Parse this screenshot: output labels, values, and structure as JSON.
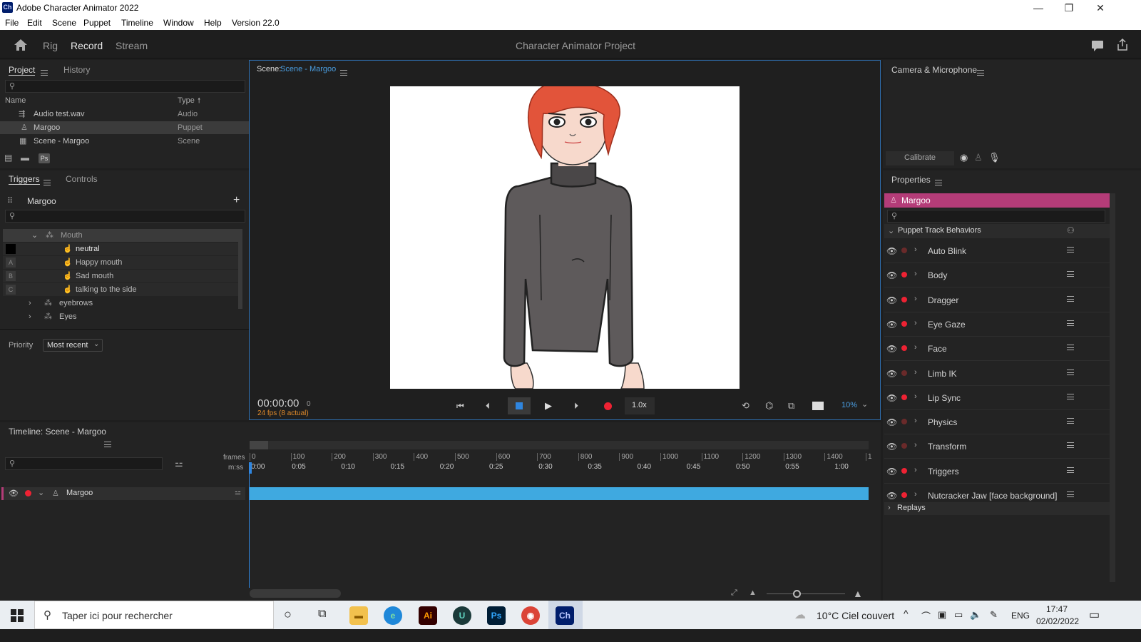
{
  "window": {
    "title": "Adobe Character Animator 2022",
    "logo_text": "Ch",
    "minimize": "—",
    "restore": "❐",
    "close": "✕"
  },
  "menu": [
    "File",
    "Edit",
    "Scene",
    "Puppet",
    "Timeline",
    "Window",
    "Help",
    "Version 22.0"
  ],
  "appbar": {
    "tabs": [
      "Rig",
      "Record",
      "Stream"
    ],
    "active": "Record",
    "project_title": "Character Animator Project"
  },
  "project_panel": {
    "tabs": [
      "Project",
      "History"
    ],
    "columns": [
      "Name",
      "Type"
    ],
    "items": [
      {
        "name": "Audio test.wav",
        "type": "Audio",
        "icon": "audio-icon"
      },
      {
        "name": "Margoo",
        "type": "Puppet",
        "icon": "puppet-icon"
      },
      {
        "name": "Scene - Margoo",
        "type": "Scene",
        "icon": "scene-icon"
      }
    ],
    "ps_label": "Ps"
  },
  "triggers_panel": {
    "tabs": [
      "Triggers",
      "Controls"
    ],
    "puppet_name": "Margoo",
    "items": [
      {
        "label": "Mouth",
        "key": ""
      },
      {
        "label": "neutral",
        "key": ""
      },
      {
        "label": "Happy mouth",
        "key": "A"
      },
      {
        "label": "Sad mouth",
        "key": "B"
      },
      {
        "label": "talking to the side",
        "key": "C"
      },
      {
        "label": "eyebrows",
        "key": ""
      },
      {
        "label": "Eyes",
        "key": ""
      }
    ],
    "priority_label": "Priority",
    "priority_value": "Most recent"
  },
  "scene_panel": {
    "label": "Scene:",
    "name": "Scene - Margoo",
    "timecode": "00:00:00",
    "frame": "0",
    "fps": "24 fps (8 actual)",
    "speed": "1.0x",
    "zoom": "10%"
  },
  "camera_panel": {
    "title": "Camera & Microphone",
    "calibrate": "Calibrate"
  },
  "properties_panel": {
    "title": "Properties",
    "puppet": "Margoo",
    "section": "Puppet Track Behaviors",
    "behaviors": [
      {
        "label": "Auto Blink",
        "armed": false
      },
      {
        "label": "Body",
        "armed": true
      },
      {
        "label": "Dragger",
        "armed": true
      },
      {
        "label": "Eye Gaze",
        "armed": true
      },
      {
        "label": "Face",
        "armed": true
      },
      {
        "label": "Limb IK",
        "armed": false
      },
      {
        "label": "Lip Sync",
        "armed": true
      },
      {
        "label": "Physics",
        "armed": false
      },
      {
        "label": "Transform",
        "armed": false
      },
      {
        "label": "Triggers",
        "armed": true
      },
      {
        "label": "Nutcracker Jaw [face background]",
        "armed": true
      }
    ],
    "replays": "Replays"
  },
  "timeline": {
    "title": "Timeline: Scene - Margoo",
    "frames_label": "frames",
    "mss_label": "m:ss",
    "frame_ticks": [
      "0",
      "100",
      "200",
      "300",
      "400",
      "500",
      "600",
      "700",
      "800",
      "900",
      "1000",
      "1100",
      "1200",
      "1300",
      "1400",
      "1"
    ],
    "time_ticks": [
      "0:00",
      "0:05",
      "0:10",
      "0:15",
      "0:20",
      "0:25",
      "0:30",
      "0:35",
      "0:40",
      "0:45",
      "0:50",
      "0:55",
      "1:00"
    ],
    "track": "Margoo",
    "track_color": "#3fa9e0"
  },
  "taskbar": {
    "search_placeholder": "Taper ici pour rechercher",
    "weather": "10°C  Ciel couvert",
    "lang": "ENG",
    "time": "17:47",
    "date": "02/02/2022",
    "apps": [
      "Ai",
      "U",
      "Ps",
      "Ch"
    ]
  }
}
